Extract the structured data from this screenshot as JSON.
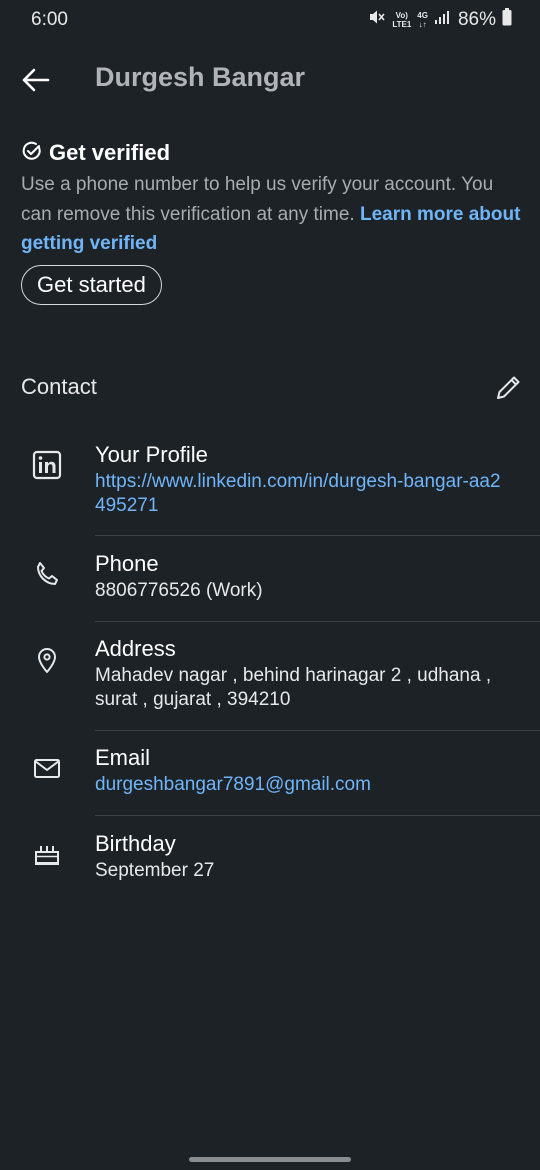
{
  "status_bar": {
    "time": "6:00",
    "network_top": "Vo)",
    "network_bottom": "LTE1",
    "data_type": "4G",
    "battery": "86%"
  },
  "header": {
    "title": "Durgesh Bangar"
  },
  "verify": {
    "title": "Get verified",
    "description": "Use a phone number to help us verify your account. You can remove this verification at any time. ",
    "learn_more": "Learn more about getting verified",
    "button_label": "Get started"
  },
  "contact": {
    "title": "Contact",
    "items": [
      {
        "label": "Your Profile",
        "value": "https://www.linkedin.com/in/durgesh-bangar-aa2495271",
        "icon": "linkedin-icon"
      },
      {
        "label": "Phone",
        "value": "8806776526 (Work)",
        "icon": "phone-icon"
      },
      {
        "label": "Address",
        "value": "Mahadev nagar , behind harinagar 2 , udhana , surat , gujarat , 394210",
        "icon": "location-pin-icon"
      },
      {
        "label": "Email",
        "value": "durgeshbangar7891@gmail.com",
        "icon": "mail-icon"
      },
      {
        "label": "Birthday",
        "value": "September 27",
        "icon": "cake-icon"
      }
    ]
  },
  "colors": {
    "background": "#1d2226",
    "link": "#70b5f9",
    "muted_text": "#a8acb0"
  }
}
